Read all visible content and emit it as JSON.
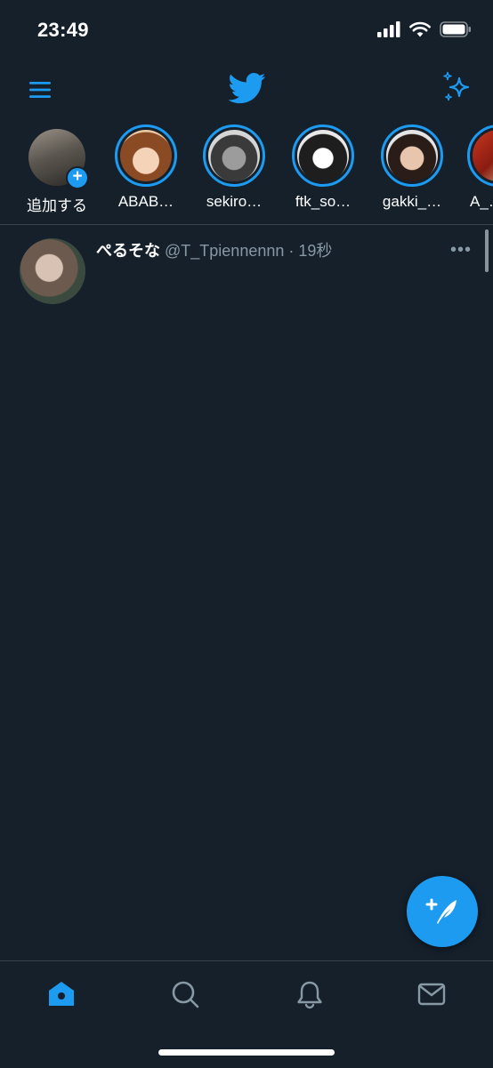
{
  "status": {
    "time": "23:49"
  },
  "header": {
    "menu_icon": "menu-icon",
    "logo": "twitter-bird-logo",
    "sparkle_icon": "sparkle-icon"
  },
  "fleets": [
    {
      "label": "追加する",
      "type": "add"
    },
    {
      "label": "ABAB…",
      "type": "user"
    },
    {
      "label": "sekiro…",
      "type": "user"
    },
    {
      "label": "ftk_so…",
      "type": "user"
    },
    {
      "label": "gakki_…",
      "type": "user"
    },
    {
      "label": "A_…",
      "type": "user"
    }
  ],
  "tweet": {
    "name": "ぺるそな",
    "handle": "@T_Tpiennennn",
    "separator": "·",
    "time": "19秒",
    "more": "•••"
  },
  "tabs": [
    "home-icon",
    "search-icon",
    "notifications-icon",
    "messages-icon"
  ],
  "colors": {
    "background": "#15202b",
    "accent": "#1d9bf0",
    "secondary_text": "#8899a6",
    "divider": "#38444d"
  }
}
